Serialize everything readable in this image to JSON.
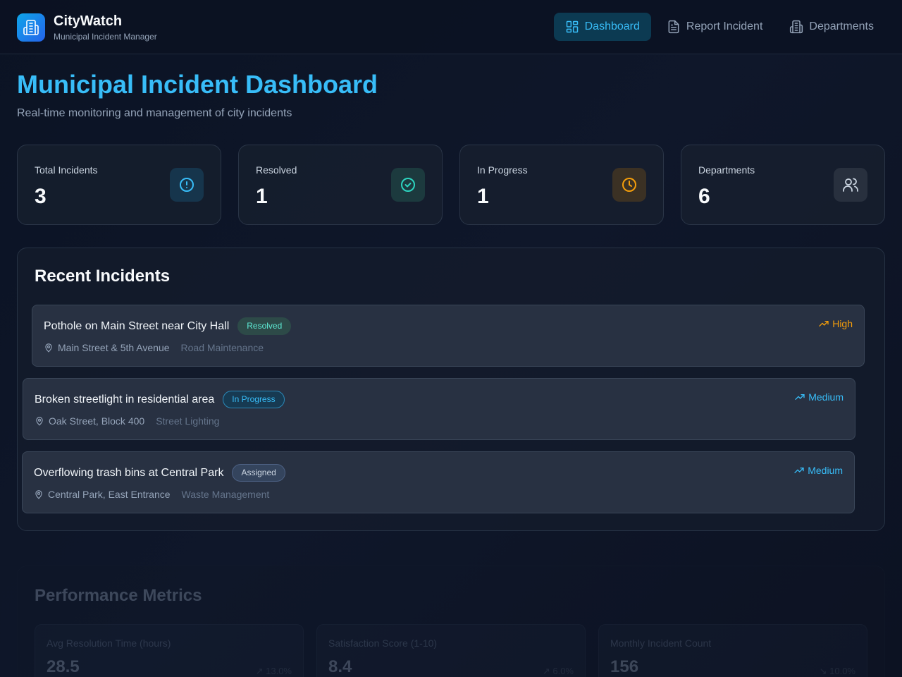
{
  "header": {
    "app_name": "CityWatch",
    "app_subtitle": "Municipal Incident Manager",
    "nav": [
      {
        "label": "Dashboard",
        "icon": "dashboard-grid-icon",
        "active": true
      },
      {
        "label": "Report Incident",
        "icon": "document-icon",
        "active": false
      },
      {
        "label": "Departments",
        "icon": "building-icon",
        "active": false
      }
    ]
  },
  "page": {
    "title": "Municipal Incident Dashboard",
    "subtitle": "Real-time monitoring and management of city incidents"
  },
  "stats": [
    {
      "label": "Total Incidents",
      "value": "3",
      "icon": "alert-circle-icon",
      "color": "#38bdf8"
    },
    {
      "label": "Resolved",
      "value": "1",
      "icon": "check-circle-icon",
      "color": "#2dd4bf"
    },
    {
      "label": "In Progress",
      "value": "1",
      "icon": "clock-icon",
      "color": "#f59e0b"
    },
    {
      "label": "Departments",
      "value": "6",
      "icon": "users-icon",
      "color": "#cbd5e1"
    }
  ],
  "recent": {
    "title": "Recent Incidents",
    "items": [
      {
        "title": "Pothole on Main Street near City Hall",
        "status": "Resolved",
        "priority": "High",
        "priority_color": "#f59e0b",
        "location": "Main Street & 5th Avenue",
        "department": "Road Maintenance"
      },
      {
        "title": "Broken streetlight in residential area",
        "status": "In Progress",
        "priority": "Medium",
        "priority_color": "#38bdf8",
        "location": "Oak Street, Block 400",
        "department": "Street Lighting"
      },
      {
        "title": "Overflowing trash bins at Central Park",
        "status": "Assigned",
        "priority": "Medium",
        "priority_color": "#38bdf8",
        "location": "Central Park, East Entrance",
        "department": "Waste Management"
      }
    ]
  },
  "performance": {
    "title": "Performance Metrics",
    "metrics": [
      {
        "label": "Avg Resolution Time (hours)",
        "value": "28.5",
        "change": "13.0%"
      },
      {
        "label": "Satisfaction Score (1-10)",
        "value": "8.4",
        "change": "6.0%"
      },
      {
        "label": "Monthly Incident Count",
        "value": "156",
        "change": "10.0%"
      }
    ]
  }
}
